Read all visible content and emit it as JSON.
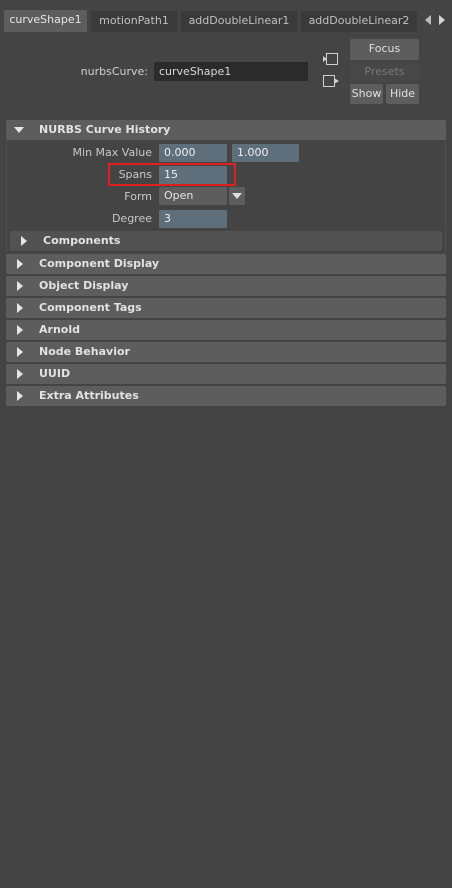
{
  "tabs": [
    {
      "label": "curveShape1",
      "active": true
    },
    {
      "label": "motionPath1",
      "active": false
    },
    {
      "label": "addDoubleLinear1",
      "active": false
    },
    {
      "label": "addDoubleLinear2",
      "active": false
    }
  ],
  "node": {
    "label": "nurbsCurve:",
    "name": "curveShape1"
  },
  "buttons": {
    "focus": "Focus",
    "presets": "Presets",
    "show": "Show",
    "hide": "Hide"
  },
  "nurbs_history": {
    "title": "NURBS Curve History",
    "min_max_label": "Min Max Value",
    "min_value": "0.000",
    "max_value": "1.000",
    "spans_label": "Spans",
    "spans_value": "15",
    "form_label": "Form",
    "form_value": "Open",
    "degree_label": "Degree",
    "degree_value": "3",
    "components_label": "Components"
  },
  "sections": [
    "Component Display",
    "Object Display",
    "Component Tags",
    "Arnold",
    "Node Behavior",
    "UUID",
    "Extra Attributes"
  ],
  "colors": {
    "background": "#444444",
    "header": "#5d5d5d",
    "numeric_field": "#5f6e7b",
    "highlight": "#e02020"
  }
}
